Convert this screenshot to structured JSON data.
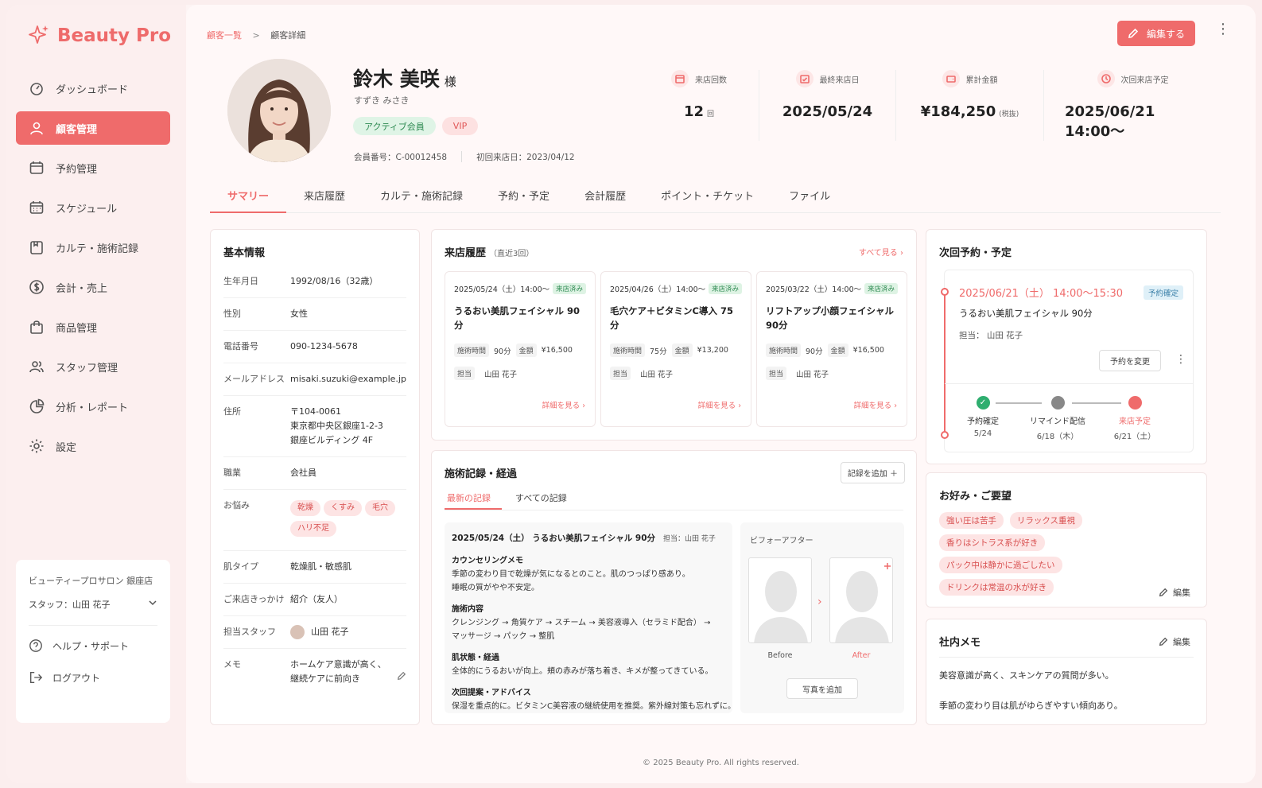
{
  "app": {
    "brand": "Beauty Pro"
  },
  "sidebar": {
    "items": [
      {
        "label": "ダッシュボード",
        "icon": "dashboard-icon"
      },
      {
        "label": "顧客管理",
        "icon": "user-icon",
        "active": true
      },
      {
        "label": "予約管理",
        "icon": "calendar-icon"
      },
      {
        "label": "スケジュール",
        "icon": "schedule-icon"
      },
      {
        "label": "カルテ・施術記録",
        "icon": "chart-record-icon"
      },
      {
        "label": "会計・売上",
        "icon": "dollar-icon"
      },
      {
        "label": "商品管理",
        "icon": "bag-icon"
      },
      {
        "label": "スタッフ管理",
        "icon": "staff-icon"
      },
      {
        "label": "分析・レポート",
        "icon": "pie-chart-icon"
      },
      {
        "label": "設定",
        "icon": "gear-icon"
      }
    ],
    "salon": "ビューティープロサロン 銀座店",
    "staff": "スタッフ：山田 花子",
    "help": "ヘルプ・サポート",
    "logout": "ログアウト"
  },
  "header": {
    "breadcrumb_root": "顧客一覧",
    "breadcrumb_sep": ">",
    "breadcrumb_current": "顧客詳細",
    "edit_label": "編集する"
  },
  "customer": {
    "name": "鈴木 美咲",
    "honorific": "様",
    "kana": "すずき みさき",
    "tags": [
      "アクティブ会員",
      "VIP"
    ],
    "member_no": "会員番号：C-00012458",
    "first_visit": "初回来店日：2023/04/12"
  },
  "stats": [
    {
      "label": "来店回数",
      "value": "12",
      "unit": "回",
      "icon": "calendar-icon"
    },
    {
      "label": "最終来店日",
      "value": "2025/05/24",
      "unit": "",
      "icon": "calendar-check-icon"
    },
    {
      "label": "累計金額",
      "value": "¥184,250",
      "unit": "(税抜)",
      "icon": "wallet-icon"
    },
    {
      "label": "次回来店予定",
      "value": "2025/06/21 14:00〜",
      "unit": "",
      "icon": "clock-icon"
    }
  ],
  "tabs": [
    "サマリー",
    "来店履歴",
    "カルテ・施術記録",
    "予約・予定",
    "会計履歴",
    "ポイント・チケット",
    "ファイル"
  ],
  "basic": {
    "title": "基本情報",
    "rows": [
      {
        "k": "生年月日",
        "v": "1992/08/16（32歳）"
      },
      {
        "k": "性別",
        "v": "女性"
      },
      {
        "k": "電話番号",
        "v": "090-1234-5678"
      },
      {
        "k": "メールアドレス",
        "v": "misaki.suzuki@example.jp"
      },
      {
        "k": "住所",
        "v1": "〒104-0061",
        "v2": "東京都中央区銀座1-2-3",
        "v3": "銀座ビルディング 4F"
      },
      {
        "k": "職業",
        "v": "会社員"
      },
      {
        "k": "お悩み",
        "chips": [
          "乾燥",
          "くすみ",
          "毛穴",
          "ハリ不足"
        ]
      },
      {
        "k": "肌タイプ",
        "v": "乾燥肌・敏感肌"
      },
      {
        "k": "ご来店きっかけ",
        "v": "紹介（友人）"
      },
      {
        "k": "担当スタッフ",
        "v": "山田 花子"
      },
      {
        "k": "メモ",
        "v1": "ホームケア意識が高く、",
        "v2": "継続ケアに前向き"
      }
    ]
  },
  "visits": {
    "title": "来店履歴",
    "sub": "（直近3回）",
    "all_link": "すべて見る",
    "items": [
      {
        "date": "2025/05/24（土）14:00〜",
        "status": "来店済み",
        "name": "うるおい美肌フェイシャル 90分",
        "time_label": "施術時間",
        "time": "90分",
        "price_label": "金額",
        "price": "¥16,500",
        "staff_label": "担当",
        "staff": "山田 花子",
        "detail": "詳細を見る"
      },
      {
        "date": "2025/04/26（土）14:00〜",
        "status": "来店済み",
        "name": "毛穴ケア＋ビタミンC導入 75分",
        "time_label": "施術時間",
        "time": "75分",
        "price_label": "金額",
        "price": "¥13,200",
        "staff_label": "担当",
        "staff": "山田 花子",
        "detail": "詳細を見る"
      },
      {
        "date": "2025/03/22（土）14:00〜",
        "status": "来店済み",
        "name": "リフトアップ小顔フェイシャル 90分",
        "time_label": "施術時間",
        "time": "90分",
        "price_label": "金額",
        "price": "¥16,500",
        "staff_label": "担当",
        "staff": "山田 花子",
        "detail": "詳細を見る"
      }
    ]
  },
  "treatment": {
    "title": "施術記録・経過",
    "add": "記録を追加 ＋",
    "tabs": [
      "最新の記録",
      "すべての記録"
    ],
    "header": "2025/05/24（土） うるおい美肌フェイシャル 90分",
    "header_staff": "担当：山田 花子",
    "counsel_title": "カウンセリングメモ",
    "counsel_1": "季節の変わり目で乾燥が気になるとのこと。肌のつっぱり感あり。",
    "counsel_2": "睡眠の質がやや不安定。",
    "content_title": "施術内容",
    "content_1": "クレンジング → 角質ケア → スチーム → 美容液導入（セラミド配合） →",
    "content_2": "マッサージ → パック → 整肌",
    "skin_title": "肌状態・経過",
    "skin_1": "全体的にうるおいが向上。頬の赤みが落ち着き、キメが整ってきている。",
    "advice_title": "次回提案・アドバイス",
    "advice_1": "保湿を重点的に。ビタミンC美容液の継続使用を推奨。紫外線対策も忘れずに。",
    "ba_title": "ビフォーアフター",
    "before": "Before",
    "after": "After",
    "add_photo": "写真を追加"
  },
  "next": {
    "title": "次回予約・予定",
    "date": "2025/06/21（土） 14:00〜15:30",
    "badge": "予約確定",
    "menu": "うるおい美肌フェイシャル 90分",
    "staff": "担当： 山田 花子",
    "change": "予約を変更",
    "steps": [
      {
        "label": "予約確定",
        "date": "5/24",
        "color": "#2fae6f"
      },
      {
        "label": "リマインド配信",
        "date": "6/18（木）",
        "color": "#888888"
      },
      {
        "label": "来店予定",
        "date": "6/21（土）",
        "color": "#ef6b6b"
      }
    ]
  },
  "prefs": {
    "title": "お好み・ご要望",
    "chips": [
      "強い圧は苦手",
      "リラックス重視",
      "香りはシトラス系が好き",
      "パック中は静かに過ごしたい",
      "ドリンクは常温の水が好き"
    ],
    "edit": "編集"
  },
  "memo": {
    "title": "社内メモ",
    "edit": "編集",
    "line1": "美容意識が高く、スキンケアの質問が多い。",
    "line2": "季節の変わり目は肌がゆらぎやすい傾向あり。"
  },
  "footer": "© 2025 Beauty Pro. All rights reserved.",
  "colors": {
    "accent": "#ef6b6b",
    "green": "#2e8a52"
  }
}
